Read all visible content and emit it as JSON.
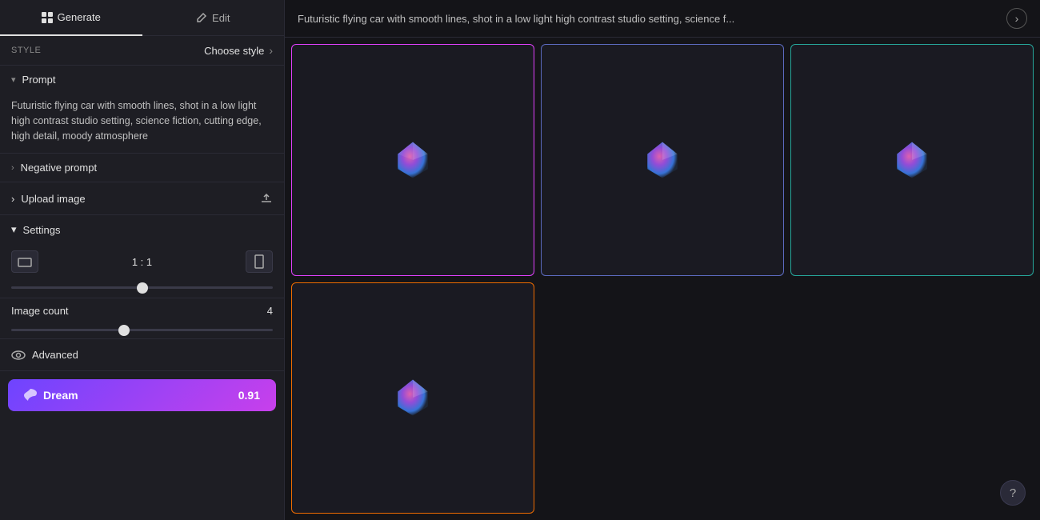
{
  "tabs": {
    "generate": "Generate",
    "edit": "Edit"
  },
  "style": {
    "label": "Style",
    "value": "Choose style"
  },
  "prompt": {
    "section_label": "Prompt",
    "text": "Futuristic flying car with smooth lines, shot in a low light high contrast studio setting, science fiction, cutting edge, high detail, moody atmosphere"
  },
  "negative_prompt": {
    "label": "Negative prompt"
  },
  "upload_image": {
    "label": "Upload image"
  },
  "settings": {
    "label": "Settings",
    "aspect_ratio": "1 : 1"
  },
  "image_count": {
    "label": "Image count",
    "value": "4"
  },
  "advanced": {
    "label": "Advanced"
  },
  "dream_button": {
    "label": "Dream",
    "cost": "0.91"
  },
  "header": {
    "title": "Futuristic flying car with smooth lines, shot in a low light high contrast studio setting, science f..."
  },
  "help": {
    "label": "?"
  },
  "images": [
    {
      "id": 1,
      "border": "pink",
      "has_content": true
    },
    {
      "id": 2,
      "border": "blue",
      "has_content": true
    },
    {
      "id": 3,
      "border": "green",
      "has_content": true
    },
    {
      "id": 4,
      "border": "orange",
      "has_content": true
    }
  ]
}
